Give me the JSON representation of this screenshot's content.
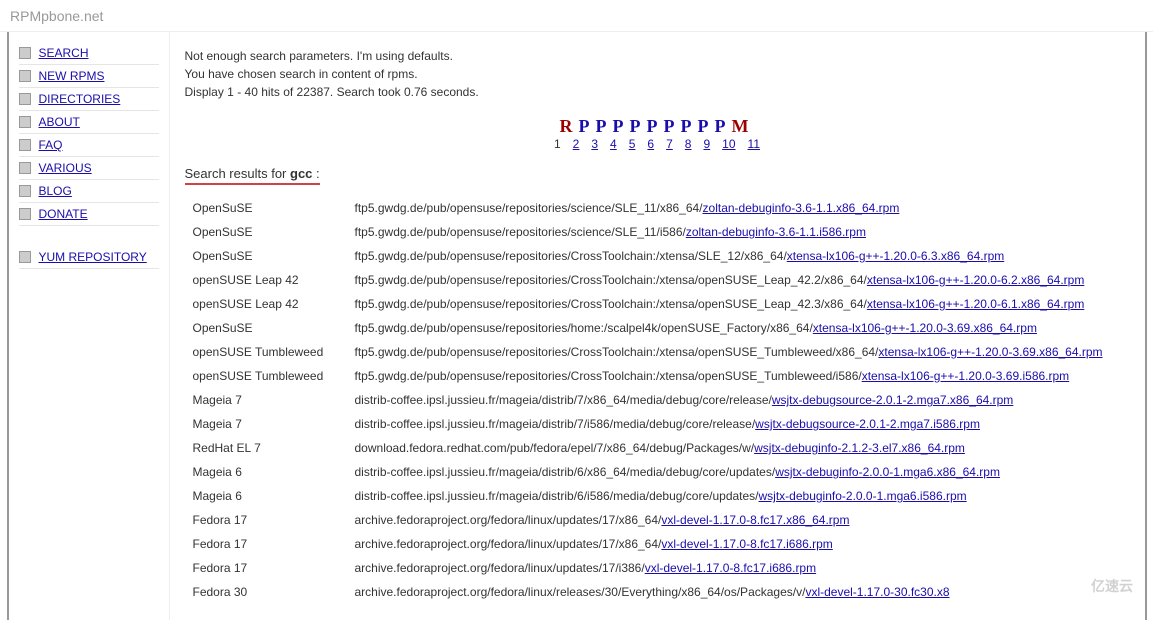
{
  "logo": {
    "main": "RPM",
    "sub": "pbone.net"
  },
  "sidebar": {
    "items": [
      {
        "label": "SEARCH"
      },
      {
        "label": "NEW RPMS"
      },
      {
        "label": "DIRECTORIES"
      },
      {
        "label": "ABOUT"
      },
      {
        "label": "FAQ"
      },
      {
        "label": "VARIOUS"
      },
      {
        "label": "BLOG"
      },
      {
        "label": "DONATE"
      }
    ],
    "extra": {
      "label": "YUM REPOSITORY"
    }
  },
  "status": {
    "line1": "Not enough search parameters. I'm using defaults.",
    "line2": "You have chosen search in content of rpms.",
    "line3": "Display 1 - 40 hits of 22387. Search took 0.76 seconds."
  },
  "pagination": {
    "letters": [
      "R",
      "P",
      "P",
      "P",
      "P",
      "P",
      "P",
      "P",
      "P",
      "P",
      "M"
    ],
    "pages": [
      "1",
      "2",
      "3",
      "4",
      "5",
      "6",
      "7",
      "8",
      "9",
      "10",
      "11"
    ],
    "current": "1"
  },
  "search": {
    "prefix": "Search results for ",
    "term": "gcc",
    "suffix": " :"
  },
  "results": [
    {
      "distro": "OpenSuSE",
      "path": "ftp5.gwdg.de/pub/opensuse/repositories/science/SLE_11/x86_64/",
      "file": "zoltan-debuginfo-3.6-1.1.x86_64.rpm"
    },
    {
      "distro": "OpenSuSE",
      "path": "ftp5.gwdg.de/pub/opensuse/repositories/science/SLE_11/i586/",
      "file": "zoltan-debuginfo-3.6-1.1.i586.rpm"
    },
    {
      "distro": "OpenSuSE",
      "path": "ftp5.gwdg.de/pub/opensuse/repositories/CrossToolchain:/xtensa/SLE_12/x86_64/",
      "file": "xtensa-lx106-g++-1.20.0-6.3.x86_64.rpm"
    },
    {
      "distro": "openSUSE Leap 42",
      "path": "ftp5.gwdg.de/pub/opensuse/repositories/CrossToolchain:/xtensa/openSUSE_Leap_42.2/x86_64/",
      "file": "xtensa-lx106-g++-1.20.0-6.2.x86_64.rpm"
    },
    {
      "distro": "openSUSE Leap 42",
      "path": "ftp5.gwdg.de/pub/opensuse/repositories/CrossToolchain:/xtensa/openSUSE_Leap_42.3/x86_64/",
      "file": "xtensa-lx106-g++-1.20.0-6.1.x86_64.rpm"
    },
    {
      "distro": "OpenSuSE",
      "path": "ftp5.gwdg.de/pub/opensuse/repositories/home:/scalpel4k/openSUSE_Factory/x86_64/",
      "file": "xtensa-lx106-g++-1.20.0-3.69.x86_64.rpm"
    },
    {
      "distro": "openSUSE Tumbleweed",
      "path": "ftp5.gwdg.de/pub/opensuse/repositories/CrossToolchain:/xtensa/openSUSE_Tumbleweed/x86_64/",
      "file": "xtensa-lx106-g++-1.20.0-3.69.x86_64.rpm"
    },
    {
      "distro": "openSUSE Tumbleweed",
      "path": "ftp5.gwdg.de/pub/opensuse/repositories/CrossToolchain:/xtensa/openSUSE_Tumbleweed/i586/",
      "file": "xtensa-lx106-g++-1.20.0-3.69.i586.rpm"
    },
    {
      "distro": "Mageia 7",
      "path": "distrib-coffee.ipsl.jussieu.fr/mageia/distrib/7/x86_64/media/debug/core/release/",
      "file": "wsjtx-debugsource-2.0.1-2.mga7.x86_64.rpm"
    },
    {
      "distro": "Mageia 7",
      "path": "distrib-coffee.ipsl.jussieu.fr/mageia/distrib/7/i586/media/debug/core/release/",
      "file": "wsjtx-debugsource-2.0.1-2.mga7.i586.rpm"
    },
    {
      "distro": "RedHat EL 7",
      "path": "download.fedora.redhat.com/pub/fedora/epel/7/x86_64/debug/Packages/w/",
      "file": "wsjtx-debuginfo-2.1.2-3.el7.x86_64.rpm"
    },
    {
      "distro": "Mageia 6",
      "path": "distrib-coffee.ipsl.jussieu.fr/mageia/distrib/6/x86_64/media/debug/core/updates/",
      "file": "wsjtx-debuginfo-2.0.0-1.mga6.x86_64.rpm"
    },
    {
      "distro": "Mageia 6",
      "path": "distrib-coffee.ipsl.jussieu.fr/mageia/distrib/6/i586/media/debug/core/updates/",
      "file": "wsjtx-debuginfo-2.0.0-1.mga6.i586.rpm"
    },
    {
      "distro": "Fedora 17",
      "path": "archive.fedoraproject.org/fedora/linux/updates/17/x86_64/",
      "file": "vxl-devel-1.17.0-8.fc17.x86_64.rpm"
    },
    {
      "distro": "Fedora 17",
      "path": "archive.fedoraproject.org/fedora/linux/updates/17/x86_64/",
      "file": "vxl-devel-1.17.0-8.fc17.i686.rpm"
    },
    {
      "distro": "Fedora 17",
      "path": "archive.fedoraproject.org/fedora/linux/updates/17/i386/",
      "file": "vxl-devel-1.17.0-8.fc17.i686.rpm"
    },
    {
      "distro": "Fedora 30",
      "path": "archive.fedoraproject.org/fedora/linux/releases/30/Everything/x86_64/os/Packages/v/",
      "file": "vxl-devel-1.17.0-30.fc30.x8"
    }
  ],
  "watermark": "亿速云"
}
